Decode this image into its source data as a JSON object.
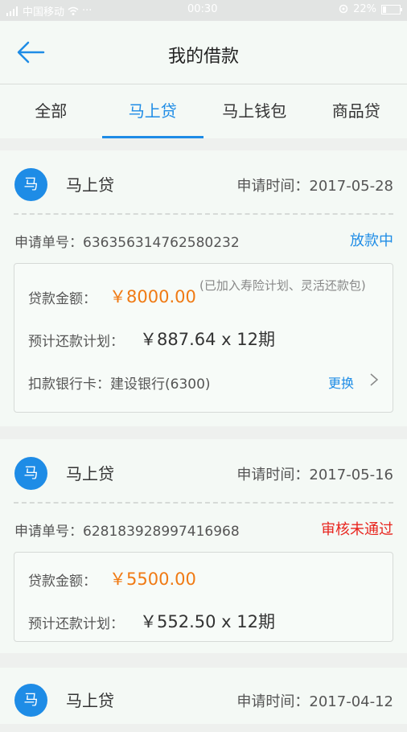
{
  "status_bar": {
    "carrier": "中国移动",
    "dots": "···",
    "time": "00:30",
    "battery": "22%",
    "battery_level": 0.22
  },
  "header": {
    "title": "我的借款"
  },
  "tabs": [
    {
      "label": "全部",
      "active": false
    },
    {
      "label": "马上贷",
      "active": true
    },
    {
      "label": "马上钱包",
      "active": false
    },
    {
      "label": "商品贷",
      "active": false
    }
  ],
  "loans": [
    {
      "avatar": "马",
      "product": "马上贷",
      "apply_time_label": "申请时间：",
      "apply_time": "2017-05-28",
      "order_label": "申请单号：",
      "order_no": "636356314762580232",
      "status": "放款中",
      "status_color": "#1e8ce6",
      "amount_label": "贷款金额：",
      "amount": "￥8000.00",
      "amount_note": "(已加入寿险计划、灵活还款包)",
      "plan_label": "预计还款计划：",
      "plan": "￥887.64 x 12期",
      "bank_label": "扣款银行卡：",
      "bank": "建设银行(6300)",
      "change_label": "更换"
    },
    {
      "avatar": "马",
      "product": "马上贷",
      "apply_time_label": "申请时间：",
      "apply_time": "2017-05-16",
      "order_label": "申请单号：",
      "order_no": "628183928997416968",
      "status": "审核未通过",
      "status_color": "#e8251e",
      "amount_label": "贷款金额：",
      "amount": "￥5500.00",
      "plan_label": "预计还款计划：",
      "plan": "￥552.50 x 12期"
    },
    {
      "avatar": "马",
      "product": "马上贷",
      "apply_time_label": "申请时间：",
      "apply_time": "2017-04-12"
    }
  ],
  "colors": {
    "accent": "#1e8ce6",
    "amount": "#f07a14",
    "rejected": "#e8251e"
  }
}
